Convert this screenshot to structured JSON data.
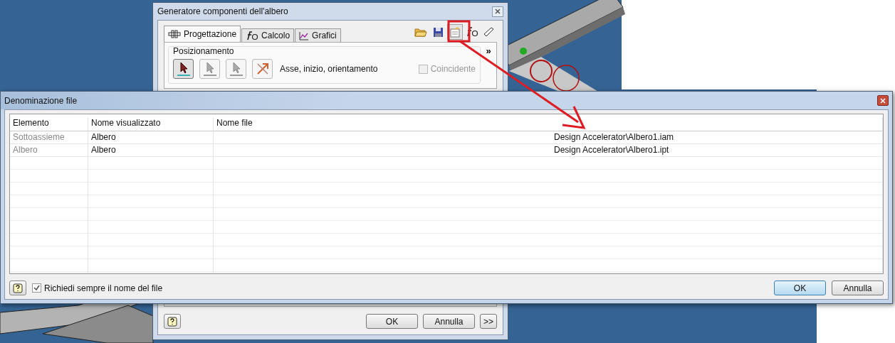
{
  "back_window": {
    "title": "Generatore componenti dell'albero",
    "tabs": [
      {
        "label": "Progettazione",
        "kind": "design",
        "selected": true
      },
      {
        "label": "Calcolo",
        "kind": "calc",
        "selected": false
      },
      {
        "label": "Grafici",
        "kind": "chart",
        "selected": false
      }
    ],
    "toolbar": [
      {
        "kind": "open",
        "highlighted": false
      },
      {
        "kind": "save",
        "highlighted": false
      },
      {
        "kind": "naming",
        "highlighted": true
      },
      {
        "kind": "formula",
        "highlighted": false
      },
      {
        "kind": "eraser",
        "highlighted": false
      }
    ],
    "expand_label": "»",
    "positioning": {
      "title": "Posizionamento",
      "tools": [
        {
          "kind": "axis",
          "selected": true
        },
        {
          "kind": "start",
          "selected": false
        },
        {
          "kind": "orient",
          "selected": false
        },
        {
          "kind": "flip",
          "selected": false
        }
      ],
      "label": "Asse, inizio, orientamento",
      "coincident": {
        "label": "Coincidente",
        "checked": false,
        "disabled": true
      }
    },
    "buttons": [
      {
        "label": "OK",
        "kind": "ok"
      },
      {
        "label": "Annulla",
        "kind": "cancel"
      },
      {
        "label": ">>",
        "kind": "more"
      }
    ]
  },
  "dialog": {
    "title": "Denominazione file",
    "table": {
      "columns": [
        "Elemento",
        "Nome visualizzato",
        "Nome file"
      ],
      "rows": [
        {
          "element": "Sottoassieme",
          "display_name": "Albero",
          "file_name": "Design Accelerator\\Albero1.iam"
        },
        {
          "element": "Albero",
          "display_name": "Albero",
          "file_name": "Design Accelerator\\Albero1.ipt"
        }
      ]
    },
    "always_ask": {
      "label": "Richiedi sempre il nome del file",
      "checked": true
    },
    "buttons": [
      {
        "label": "OK",
        "kind": "ok"
      },
      {
        "label": "Annulla",
        "kind": "cancel"
      }
    ]
  }
}
